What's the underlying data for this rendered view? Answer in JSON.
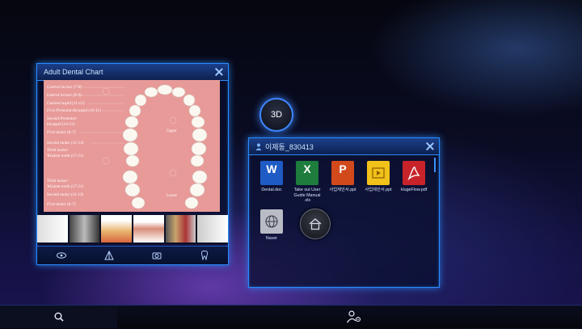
{
  "dental_window": {
    "title": "Adult Dental Chart",
    "upper_labels": [
      "Central incisor (7-8)",
      "Lateral incisor (8-9)",
      "Canine/cuspid (11-12)",
      "First Premolar/bicuspid (10-11)",
      "Second Premolar/",
      "bicuspid (10-12)",
      "First molar (6-7)",
      "Second molar (12-13)",
      "Third molar/",
      "Wisdom tooth (17-21)"
    ],
    "lower_labels": [
      "Third molar/",
      "Wisdom tooth (17-21)",
      "Second molar (11-13)",
      "First molar (6-7)"
    ],
    "jaw_upper": "Upper",
    "jaw_lower": "Lower",
    "toolbar_icons": [
      "eye-icon",
      "prism-icon",
      "camera-icon",
      "tooth-icon"
    ]
  },
  "files_window": {
    "title": "이제동_830413",
    "files": [
      {
        "name": "Dental.doc",
        "letter": "W",
        "color": "#1f5bc4"
      },
      {
        "name": "Take out User Guide Manual .xls",
        "letter": "X",
        "color": "#1e7c3c"
      },
      {
        "name": "사업제안서.ppt",
        "letter": "P",
        "color": "#d2491c"
      },
      {
        "name": "사업제안서.ppt",
        "letter": "",
        "color": "#f2c21a"
      },
      {
        "name": "HugeFlow.pdf",
        "letter": "",
        "color": "#c8232a"
      },
      {
        "name": "Naver",
        "letter": "",
        "color": "#b9bcc4"
      }
    ]
  },
  "buttons": {
    "three_d": "3D"
  },
  "taskbar": {
    "icons": [
      "search-icon",
      "user-settings-icon"
    ]
  }
}
